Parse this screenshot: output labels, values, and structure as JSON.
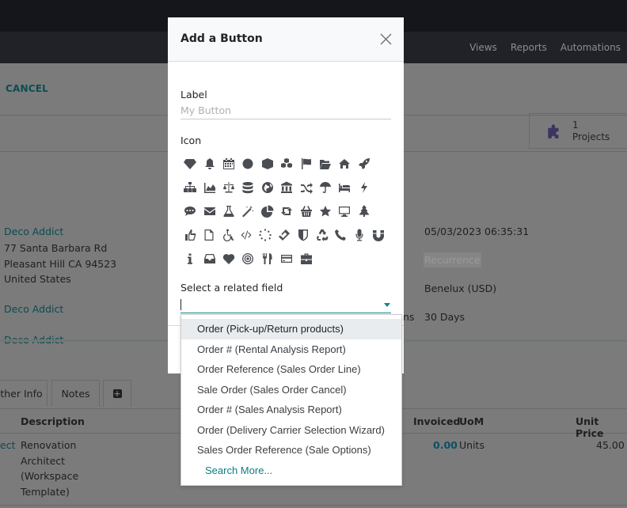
{
  "topbar": {
    "menu_items": [
      "Views",
      "Reports",
      "Automations"
    ]
  },
  "background": {
    "cancel_label": "CANCEL",
    "smart_button": {
      "count": "1",
      "label": "Projects",
      "icon": "puzzle-icon"
    },
    "customer": {
      "name": "Deco Addict",
      "address_lines": [
        "77 Santa Barbara Rd",
        "Pleasant Hill CA 94523",
        "United States"
      ],
      "invoice_address": "Deco Addict",
      "delivery_address": "Deco Addict"
    },
    "right_fields": {
      "date": "05/03/2023 06:35:31",
      "recurrence_placeholder": "Recurrence",
      "pricelist": "Benelux (USD)",
      "payment_terms_label_fragment": "ns",
      "payment_terms": "30 Days"
    },
    "tabs": [
      "ther Info",
      "Notes",
      "+"
    ],
    "table": {
      "headers": [
        "Description",
        "Invoiced",
        "UoM",
        "Unit Price"
      ],
      "row": {
        "product_fragment": "ect",
        "description_lines": [
          "Renovation",
          "Architect",
          "(Workspace",
          "Template)"
        ],
        "invoiced": "0.00",
        "uom": "Units",
        "unit_price": "45.00"
      }
    }
  },
  "modal": {
    "title": "Add a Button",
    "label_field": {
      "label": "Label",
      "value": "",
      "placeholder": "My Button"
    },
    "icon_label": "Icon",
    "icons": [
      [
        "diamond",
        "bell",
        "calendar",
        "circle",
        "cube",
        "cubes",
        "flag",
        "folder-open",
        "home",
        "rocket"
      ],
      [
        "sitemap",
        "area-chart",
        "balance-scale",
        "database",
        "globe",
        "university",
        "random",
        "umbrella",
        "bed",
        "bolt"
      ],
      [
        "comment",
        "envelope",
        "flask",
        "magic",
        "pie-chart",
        "retweet",
        "shopping-basket",
        "star",
        "desktop",
        "tree"
      ],
      [
        "thumbs-o-up",
        "file-o",
        "wheelchair",
        "code",
        "spinner",
        "ticket",
        "shield",
        "recycle",
        "phone",
        "microphone",
        "magnet"
      ],
      [
        "info",
        "inbox",
        "heart",
        "bullseye",
        "cutlery",
        "credit-card",
        "briefcase"
      ]
    ],
    "related_field": {
      "label": "Select a related field",
      "value": ""
    }
  },
  "dropdown": {
    "options": [
      "Order (Pick-up/Return products)",
      "Order # (Rental Analysis Report)",
      "Order Reference (Sales Order Line)",
      "Sale Order (Sales Order Cancel)",
      "Order # (Sales Analysis Report)",
      "Order (Delivery Carrier Selection Wizard)",
      "Sales Order Reference (Sale Options)"
    ],
    "active_index": 0,
    "search_more": "Search More..."
  },
  "colors": {
    "accent": "#0f878c",
    "link": "#0f7c80",
    "overlay_bg": "#7b7b7b"
  }
}
